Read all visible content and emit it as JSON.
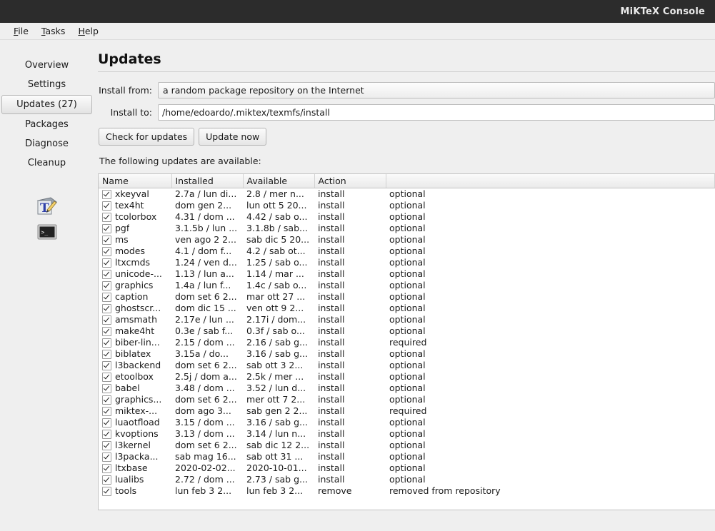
{
  "window": {
    "title": "MiKTeX Console"
  },
  "menubar": {
    "items": [
      {
        "label": "File",
        "mnemonic": "F"
      },
      {
        "label": "Tasks",
        "mnemonic": "T"
      },
      {
        "label": "Help",
        "mnemonic": "H"
      }
    ]
  },
  "sidebar": {
    "items": [
      {
        "label": "Overview",
        "selected": false
      },
      {
        "label": "Settings",
        "selected": false
      },
      {
        "label": "Updates (27)",
        "selected": true
      },
      {
        "label": "Packages",
        "selected": false
      },
      {
        "label": "Diagnose",
        "selected": false
      },
      {
        "label": "Cleanup",
        "selected": false
      }
    ],
    "icons": [
      {
        "name": "texworks-icon"
      },
      {
        "name": "terminal-icon"
      }
    ]
  },
  "main": {
    "page_title": "Updates",
    "install_from_label": "Install from:",
    "install_from_value": "a random package repository on the Internet",
    "install_to_label": "Install to:",
    "install_to_value": "/home/edoardo/.miktex/texmfs/install",
    "check_button": "Check for updates",
    "update_button": "Update now",
    "hint": "The following updates are available:"
  },
  "table": {
    "columns": [
      "Name",
      "Installed",
      "Available",
      "Action",
      ""
    ],
    "rows": [
      {
        "checked": true,
        "name": "xkeyval",
        "installed": "2.7a / lun di...",
        "available": "2.8 / mer n...",
        "action": "install",
        "note": "optional"
      },
      {
        "checked": true,
        "name": "tex4ht",
        "installed": "dom gen 2...",
        "available": "lun ott 5 20...",
        "action": "install",
        "note": "optional"
      },
      {
        "checked": true,
        "name": "tcolorbox",
        "installed": "4.31 / dom ...",
        "available": "4.42 / sab o...",
        "action": "install",
        "note": "optional"
      },
      {
        "checked": true,
        "name": "pgf",
        "installed": "3.1.5b / lun ...",
        "available": "3.1.8b / sab...",
        "action": "install",
        "note": "optional"
      },
      {
        "checked": true,
        "name": "ms",
        "installed": "ven ago 2 2...",
        "available": "sab dic 5 20...",
        "action": "install",
        "note": "optional"
      },
      {
        "checked": true,
        "name": "modes",
        "installed": "4.1 / dom f...",
        "available": "4.2 / sab ot...",
        "action": "install",
        "note": "optional"
      },
      {
        "checked": true,
        "name": "ltxcmds",
        "installed": "1.24 / ven d...",
        "available": "1.25 / sab o...",
        "action": "install",
        "note": "optional"
      },
      {
        "checked": true,
        "name": "unicode-...",
        "installed": "1.13 / lun a...",
        "available": "1.14 / mar ...",
        "action": "install",
        "note": "optional"
      },
      {
        "checked": true,
        "name": "graphics",
        "installed": "1.4a / lun f...",
        "available": "1.4c / sab o...",
        "action": "install",
        "note": "optional"
      },
      {
        "checked": true,
        "name": "caption",
        "installed": "dom set 6 2...",
        "available": "mar ott 27 ...",
        "action": "install",
        "note": "optional"
      },
      {
        "checked": true,
        "name": "ghostscr...",
        "installed": "dom dic 15 ...",
        "available": "ven ott 9 2...",
        "action": "install",
        "note": "optional"
      },
      {
        "checked": true,
        "name": "amsmath",
        "installed": "2.17e / lun ...",
        "available": "2.17i / dom...",
        "action": "install",
        "note": "optional"
      },
      {
        "checked": true,
        "name": "make4ht",
        "installed": "0.3e / sab f...",
        "available": "0.3f / sab o...",
        "action": "install",
        "note": "optional"
      },
      {
        "checked": true,
        "name": "biber-lin...",
        "installed": "2.15 / dom ...",
        "available": "2.16 / sab g...",
        "action": "install",
        "note": "required"
      },
      {
        "checked": true,
        "name": "biblatex",
        "installed": "3.15a / do...",
        "available": "3.16 / sab g...",
        "action": "install",
        "note": "optional"
      },
      {
        "checked": true,
        "name": "l3backend",
        "installed": "dom set 6 2...",
        "available": "sab ott 3 2...",
        "action": "install",
        "note": "optional"
      },
      {
        "checked": true,
        "name": "etoolbox",
        "installed": "2.5j / dom a...",
        "available": "2.5k / mer ...",
        "action": "install",
        "note": "optional"
      },
      {
        "checked": true,
        "name": "babel",
        "installed": "3.48 / dom ...",
        "available": "3.52 / lun d...",
        "action": "install",
        "note": "optional"
      },
      {
        "checked": true,
        "name": "graphics...",
        "installed": "dom set 6 2...",
        "available": "mer ott 7 2...",
        "action": "install",
        "note": "optional"
      },
      {
        "checked": true,
        "name": "miktex-...",
        "installed": "dom ago 3...",
        "available": "sab gen 2 2...",
        "action": "install",
        "note": "required"
      },
      {
        "checked": true,
        "name": "luaotfload",
        "installed": "3.15 / dom ...",
        "available": "3.16 / sab g...",
        "action": "install",
        "note": "optional"
      },
      {
        "checked": true,
        "name": "kvoptions",
        "installed": "3.13 / dom ...",
        "available": "3.14 / lun n...",
        "action": "install",
        "note": "optional"
      },
      {
        "checked": true,
        "name": "l3kernel",
        "installed": "dom set 6 2...",
        "available": "sab dic 12 2...",
        "action": "install",
        "note": "optional"
      },
      {
        "checked": true,
        "name": "l3packa...",
        "installed": "sab mag 16...",
        "available": "sab ott 31 ...",
        "action": "install",
        "note": "optional"
      },
      {
        "checked": true,
        "name": "ltxbase",
        "installed": "2020-02-02...",
        "available": "2020-10-01...",
        "action": "install",
        "note": "optional"
      },
      {
        "checked": true,
        "name": "lualibs",
        "installed": "2.72 / dom ...",
        "available": "2.73 / sab g...",
        "action": "install",
        "note": "optional"
      },
      {
        "checked": true,
        "name": "tools",
        "installed": "lun feb 3 2...",
        "available": "lun feb 3 2...",
        "action": "remove",
        "note": "removed from repository"
      }
    ]
  },
  "colors": {
    "titlebar_bg": "#2c2c2c",
    "titlebar_fg": "#e9e9e9",
    "window_bg": "#efefef",
    "table_bg": "#ffffff",
    "border": "#c3c3c3"
  }
}
